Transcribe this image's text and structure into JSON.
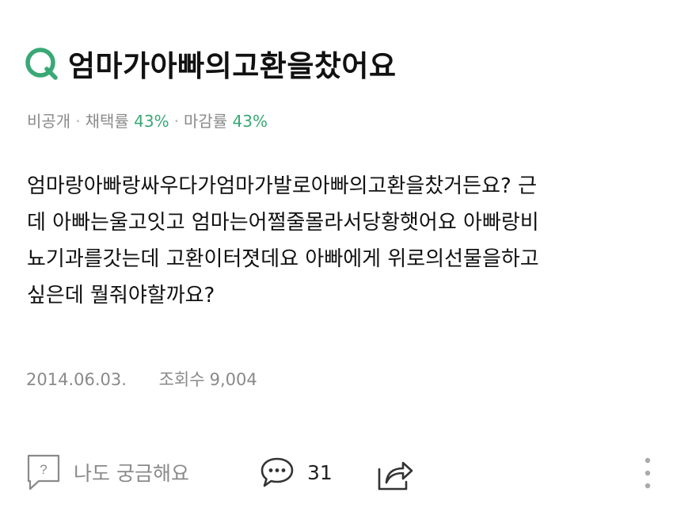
{
  "question": {
    "icon": "question-q-icon",
    "title": "엄마가아빠의고환을찼어요"
  },
  "meta": {
    "visibility": "비공개",
    "separator": "·",
    "adoption_label": "채택률",
    "adoption_rate": "43%",
    "closing_label": "마감률",
    "closing_rate": "43%"
  },
  "body": {
    "lines": [
      "엄마랑아빠랑싸우다가엄마가발로아빠의고환을찼거든요? 근",
      "데 아빠는울고잇고 엄마는어쩔줄몰라서당황햇어요 아빠랑비",
      "뇨기과를갓는데 고환이터졋데요 아빠에게 위로의선물을하고",
      "싶은데 뭘줘야할까요?"
    ]
  },
  "sub_meta": {
    "date": "2014.06.03.",
    "views_label": "조회수",
    "views_count": "9,004"
  },
  "actions": {
    "curious_label": "나도 궁금해요",
    "curious_icon_glyph": "?",
    "comment_count": "31",
    "icons": [
      "question-bubble-icon",
      "comment-bubble-icon",
      "share-icon",
      "more-vertical-icon"
    ]
  },
  "colors": {
    "accent": "#3aa876",
    "text": "#111111",
    "muted": "#8a8a8a",
    "icon": "#555555"
  }
}
